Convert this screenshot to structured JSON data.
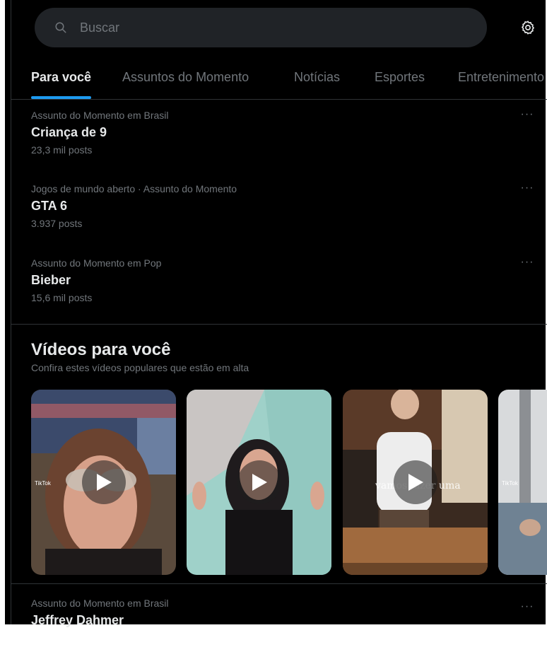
{
  "search": {
    "placeholder": "Buscar"
  },
  "tabs": [
    {
      "label": "Para você",
      "active": true
    },
    {
      "label": "Assuntos do Momento",
      "active": false
    },
    {
      "label": "Notícias",
      "active": false
    },
    {
      "label": "Esportes",
      "active": false
    },
    {
      "label": "Entretenimento",
      "active": false
    }
  ],
  "trends": [
    {
      "context": "Assunto do Momento em Brasil",
      "name": "Criança de 9",
      "count": "23,3 mil posts"
    },
    {
      "context": "Jogos de mundo aberto · Assunto do Momento",
      "name": "GTA 6",
      "count": "3.937 posts"
    },
    {
      "context": "Assunto do Momento em Pop",
      "name": "Bieber",
      "count": "15,6 mil posts"
    },
    {
      "context": "Assunto do Momento em Brasil",
      "name": "Jeffrey Dahmer",
      "count": ""
    }
  ],
  "videos": {
    "title": "Vídeos para você",
    "subtitle": "Confira estes vídeos populares que estão em alta",
    "items": [
      {
        "watermark": "TikTok",
        "overlay": ""
      },
      {
        "watermark": "",
        "overlay": ""
      },
      {
        "watermark": "",
        "overlay": "vamos fazer uma"
      },
      {
        "watermark": "TikTok",
        "overlay": ""
      }
    ]
  },
  "icons": {
    "search": "search-icon",
    "settings": "gear-icon",
    "more": "more-icon",
    "play": "play-icon"
  },
  "colors": {
    "background": "#000000",
    "accent": "#1d9bf0",
    "primary_text": "#e7e9ea",
    "secondary_text": "#71767b",
    "search_bg": "#202327",
    "border": "#2f3336"
  }
}
